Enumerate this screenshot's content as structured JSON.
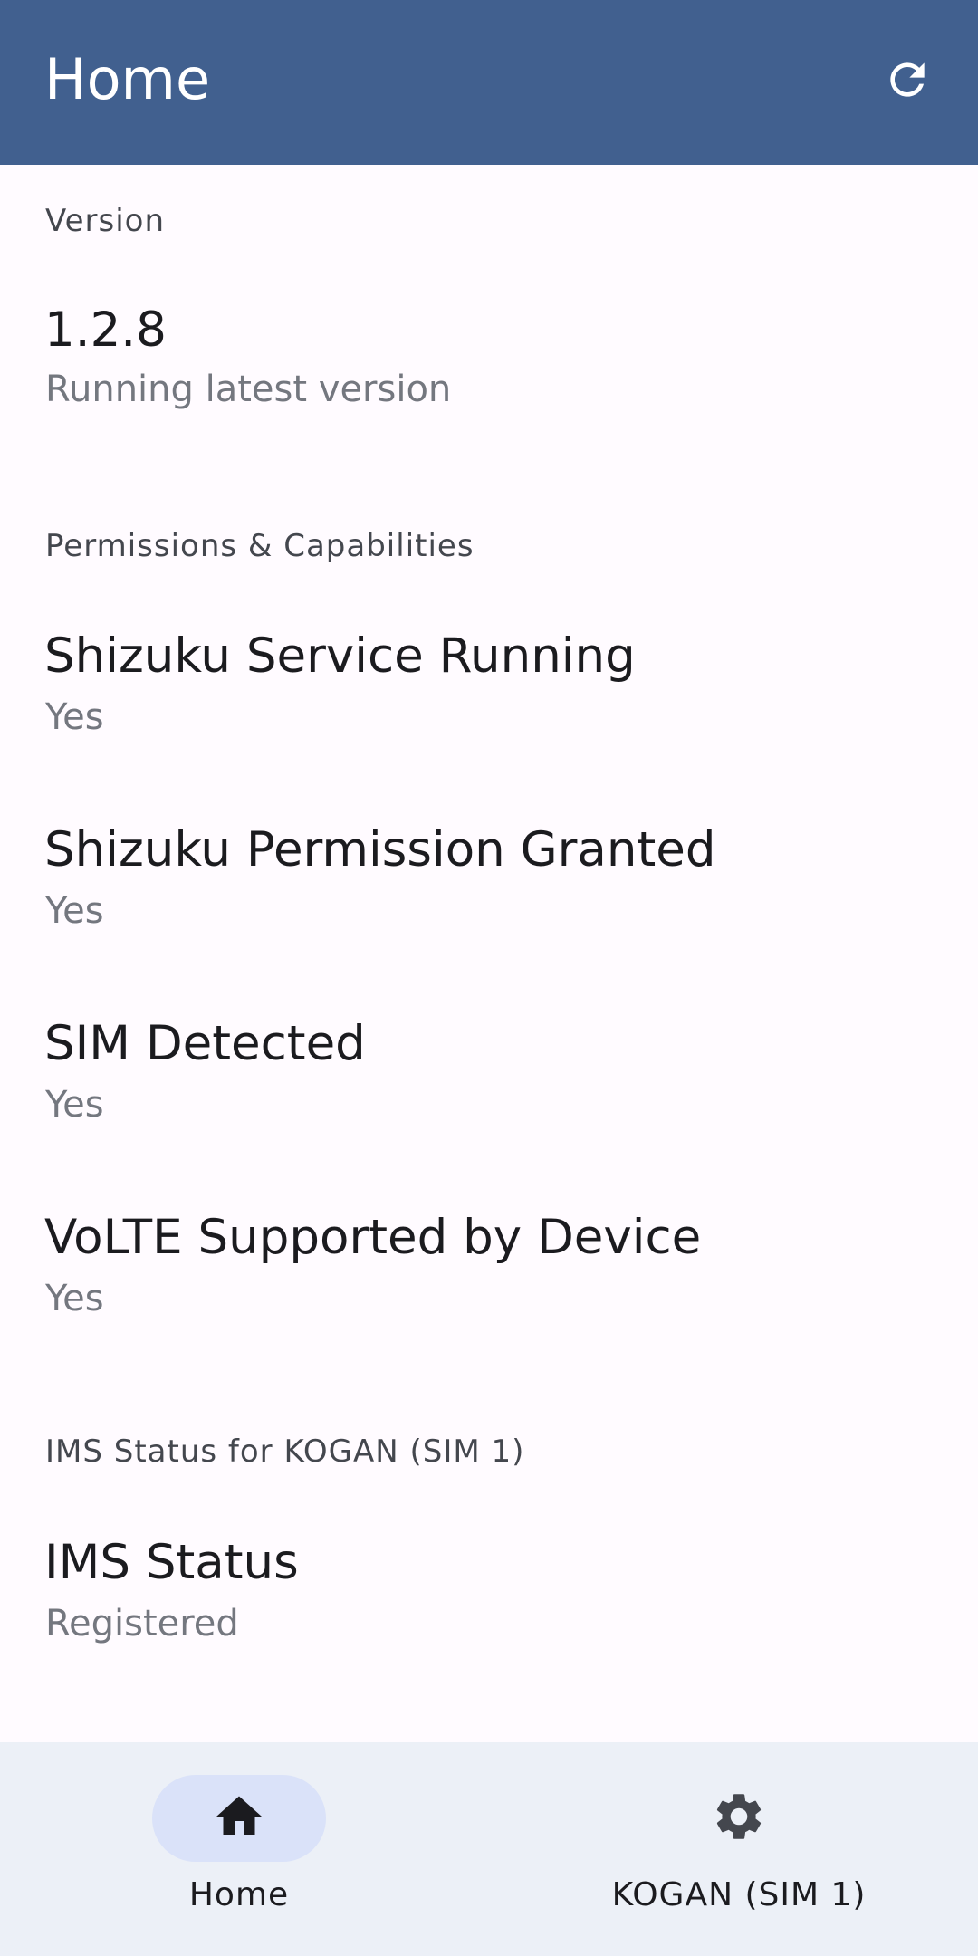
{
  "app": {
    "title": "Home",
    "colors": {
      "primary": "#41608f",
      "background": "#fffbff",
      "nav_background": "#ecf0f7",
      "nav_active": "#dae2f9"
    }
  },
  "sections": {
    "version": {
      "header": "Version",
      "rows": [
        {
          "title": "1.2.8",
          "subtitle": "Running latest version"
        }
      ]
    },
    "permissions": {
      "header": "Permissions & Capabilities",
      "rows": [
        {
          "title": "Shizuku Service Running",
          "subtitle": "Yes"
        },
        {
          "title": "Shizuku Permission Granted",
          "subtitle": "Yes"
        },
        {
          "title": "SIM Detected",
          "subtitle": "Yes"
        },
        {
          "title": "VoLTE Supported by Device",
          "subtitle": "Yes"
        }
      ]
    },
    "ims": {
      "header": "IMS Status for KOGAN (SIM 1)",
      "rows": [
        {
          "title": "IMS Status",
          "subtitle": "Registered"
        }
      ]
    }
  },
  "bottom_nav": {
    "items": [
      {
        "label": "Home",
        "icon": "home-icon",
        "active": true
      },
      {
        "label": "KOGAN (SIM 1)",
        "icon": "gear-icon",
        "active": false
      }
    ]
  }
}
